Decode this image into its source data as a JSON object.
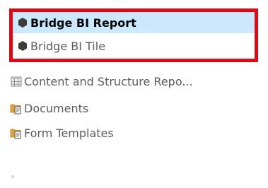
{
  "list": {
    "items": [
      {
        "label": "Bridge BI Report",
        "icon": "hexagon-icon",
        "state": "selected"
      },
      {
        "label": "Bridge BI Tile",
        "icon": "hexagon-icon",
        "state": "highlighted"
      },
      {
        "label": "Content and Structure Repo...",
        "icon": "table-icon",
        "state": "normal"
      },
      {
        "label": "Documents",
        "icon": "document-library-icon",
        "state": "normal"
      },
      {
        "label": "Form Templates",
        "icon": "form-library-icon",
        "state": "normal"
      }
    ]
  },
  "colors": {
    "selection": "#cce8ff",
    "highlight_border": "#e30613",
    "hexagon": "#3c3c3c",
    "folder": "#e0a33c"
  }
}
